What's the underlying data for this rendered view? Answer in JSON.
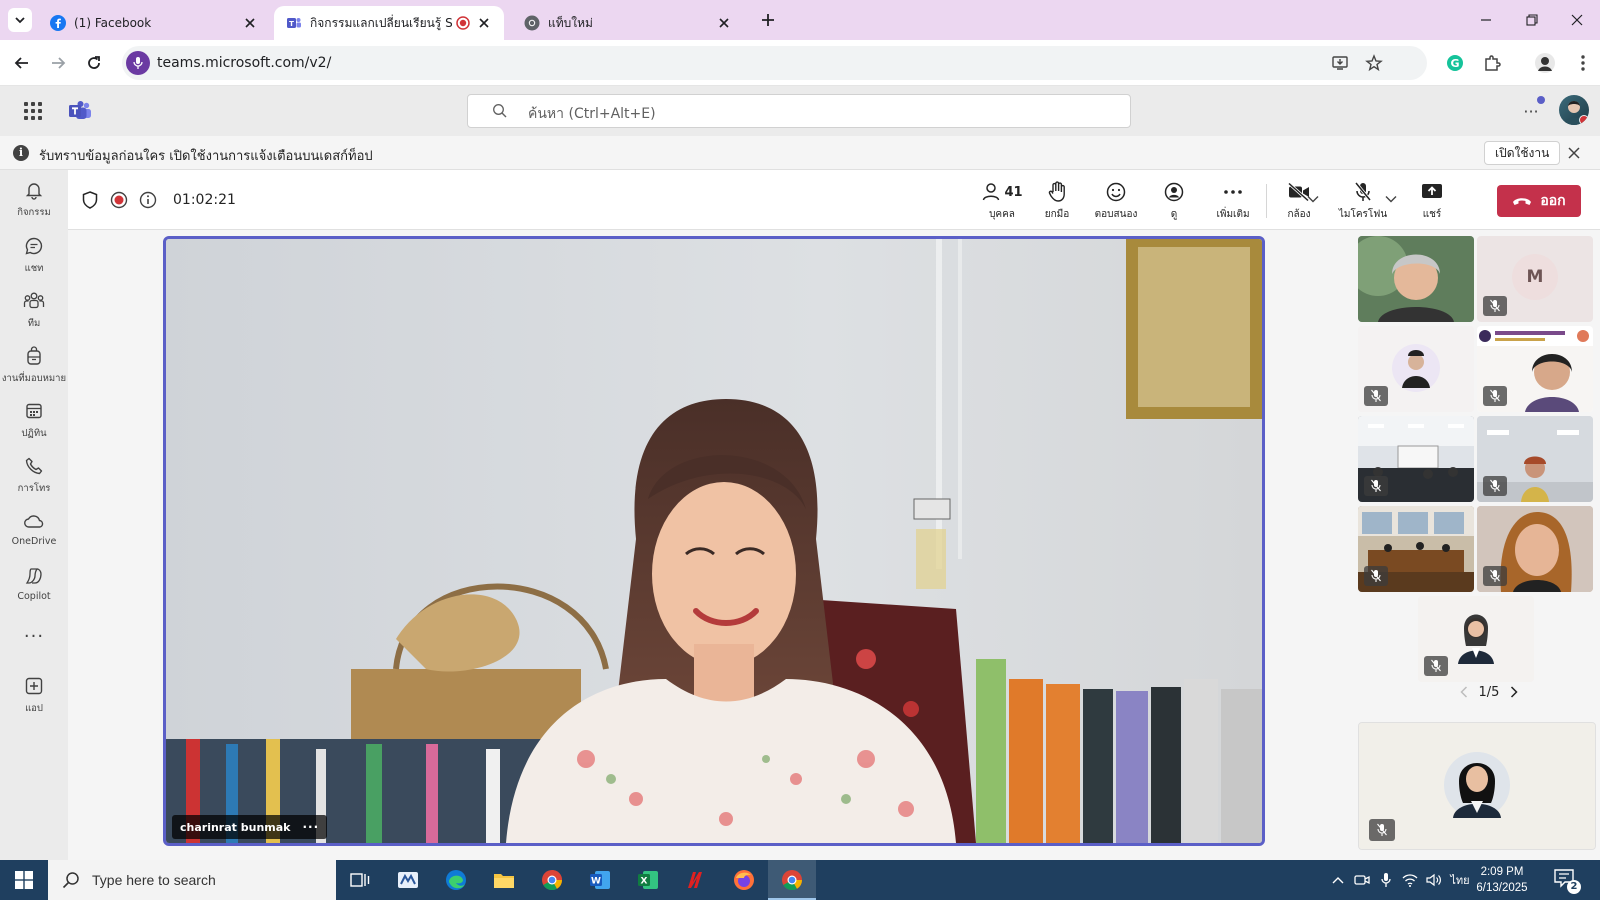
{
  "browser": {
    "tabs": [
      {
        "title": "(1) Facebook",
        "favicon": "facebook-icon"
      },
      {
        "title": "กิจกรรมแลกเปลี่ยนเรียนรู้ SAR",
        "favicon": "teams-icon",
        "recording": true
      },
      {
        "title": "แท็บใหม่",
        "favicon": "chrome-icon"
      }
    ],
    "url": "teams.microsoft.com/v2/"
  },
  "teams_header": {
    "search_placeholder": "ค้นหา (Ctrl+Alt+E)",
    "more": "···"
  },
  "banner": {
    "message": "รับทราบข้อมูลก่อนใคร เปิดใช้งานการแจ้งเตือนบนเดสก์ท็อป",
    "button": "เปิดใช้งาน"
  },
  "rail": [
    {
      "label": "กิจกรรม",
      "icon": "bell-icon"
    },
    {
      "label": "แชท",
      "icon": "chat-icon"
    },
    {
      "label": "ทีม",
      "icon": "people-icon"
    },
    {
      "label": "งานที่มอบหมาย",
      "icon": "backpack-icon"
    },
    {
      "label": "ปฏิทิน",
      "icon": "calendar-icon"
    },
    {
      "label": "การโทร",
      "icon": "phone-icon"
    },
    {
      "label": "OneDrive",
      "icon": "cloud-icon"
    },
    {
      "label": "Copilot",
      "icon": "copilot-icon"
    },
    {
      "label": "แอป",
      "icon": "add-app-icon"
    }
  ],
  "meeting": {
    "timer": "01:02:21",
    "toolbar": {
      "people_label": "บุคคล",
      "people_count": "41",
      "raise_label": "ยกมือ",
      "react_label": "ตอบสนอง",
      "view_label": "ดู",
      "more_label": "เพิ่มเติม",
      "camera_label": "กล้อง",
      "mic_label": "ไมโครโฟน",
      "share_label": "แชร์",
      "leave_label": "ออก"
    },
    "main_speaker": "charinrat bunmak",
    "participant_initial": "M",
    "pager": "1/5",
    "colors": {
      "accent": "#5b5fc7",
      "leave": "#c4314b"
    }
  },
  "taskbar": {
    "search_placeholder": "Type here to search",
    "apps": [
      "task-view-icon",
      "mail-app-icon",
      "edge-icon",
      "file-explorer-icon",
      "chrome-icon",
      "word-icon",
      "excel-icon",
      "n-app-icon",
      "firefox-icon",
      "chrome-icon"
    ],
    "language": "ไทย",
    "time": "2:09 PM",
    "date": "6/13/2025",
    "notifications": "2"
  }
}
